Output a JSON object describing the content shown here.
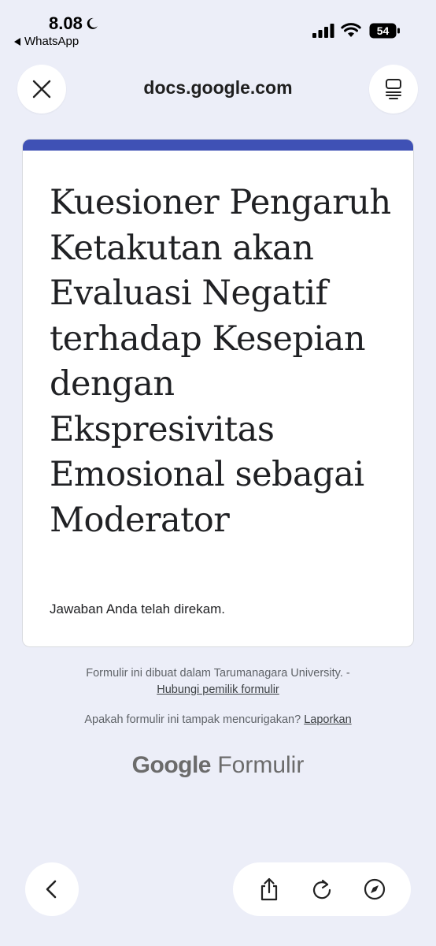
{
  "status_bar": {
    "time": "8.08",
    "back_app": "WhatsApp",
    "battery": "54"
  },
  "browser": {
    "url": "docs.google.com",
    "icons": [
      "close-icon",
      "reader-mode-icon",
      "back-icon",
      "share-icon",
      "reload-icon",
      "compass-icon"
    ]
  },
  "form": {
    "accent_color": "#3f51b5",
    "title": "Kuesioner Pengaruh Ketakutan akan Evaluasi Negatif terhadap Kesepian dengan Ekspresivitas Emosional sebagai Moderator",
    "response_message": "Jawaban Anda telah direkam."
  },
  "footer": {
    "created_text": "Formulir ini dibuat dalam Tarumanagara University. -",
    "contact_link": "Hubungi pemilik formulir",
    "suspicious_text": "Apakah formulir ini tampak mencurigakan?",
    "report_link": "Laporkan",
    "brand_google": "Google",
    "brand_product": "Formulir"
  }
}
